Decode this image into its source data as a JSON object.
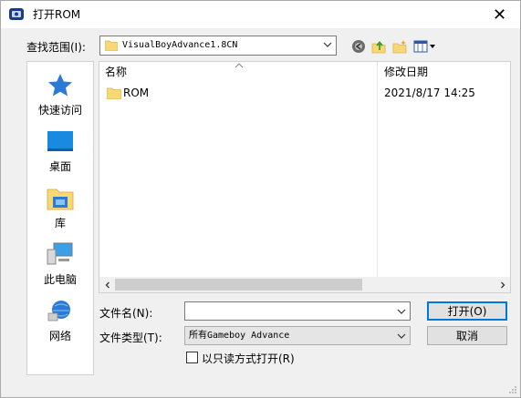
{
  "window": {
    "title": "打开ROM",
    "close_glyph": "✕"
  },
  "lookin": {
    "label": "查找范围(I):",
    "value": "VisualBoyAdvance1.8CN"
  },
  "toolbar": {
    "icons": [
      "back-globe-icon",
      "up-folder-icon",
      "new-folder-icon",
      "view-menu-icon"
    ]
  },
  "places": [
    {
      "label": "快速访问",
      "icon": "star-icon"
    },
    {
      "label": "桌面",
      "icon": "desktop-icon"
    },
    {
      "label": "库",
      "icon": "library-icon"
    },
    {
      "label": "此电脑",
      "icon": "computer-icon"
    },
    {
      "label": "网络",
      "icon": "network-icon"
    }
  ],
  "filelist": {
    "columns": [
      "名称",
      "修改日期"
    ],
    "rows": [
      {
        "name": "ROM",
        "date": "2021/8/17 14:25",
        "icon": "folder-icon"
      }
    ]
  },
  "form": {
    "filename_label": "文件名(N):",
    "filename_value": "",
    "filetype_label": "文件类型(T):",
    "filetype_value": "所有Gameboy Advance",
    "readonly_label": "以只读方式打开(R)",
    "readonly_checked": false
  },
  "buttons": {
    "open": "打开(O)",
    "cancel": "取消"
  },
  "colors": {
    "accent": "#0078d7",
    "folder": "#f8d775",
    "window_bg": "#f0f0f0"
  }
}
